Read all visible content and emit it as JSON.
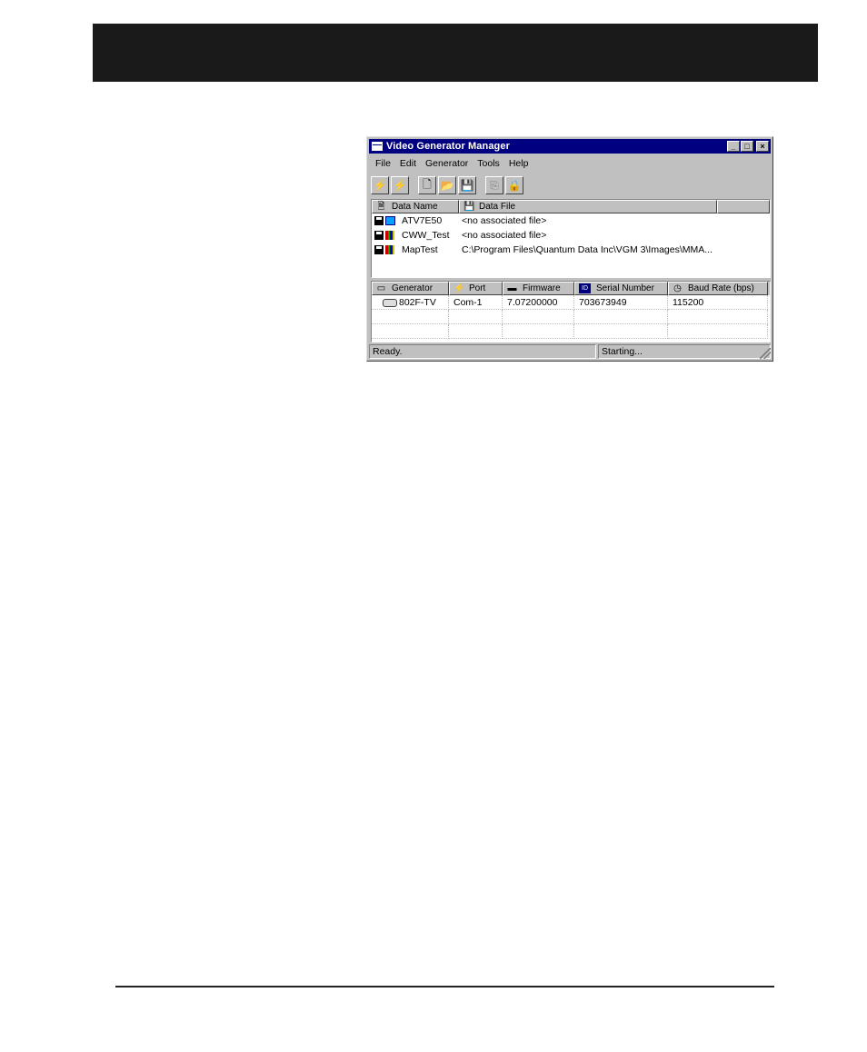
{
  "window": {
    "title": "Video Generator Manager",
    "controls": {
      "minimize": "_",
      "maximize": "□",
      "close": "×"
    }
  },
  "menu": [
    "File",
    "Edit",
    "Generator",
    "Tools",
    "Help"
  ],
  "toolbar": {
    "buttons": [
      {
        "name": "connect-icon",
        "glyph": "⚡"
      },
      {
        "name": "disconnect-icon",
        "glyph": "⚡"
      },
      {
        "name": "new-icon",
        "glyph": "🗋"
      },
      {
        "name": "open-folder-icon",
        "glyph": "📂"
      },
      {
        "name": "save-icon",
        "glyph": "💾"
      },
      {
        "name": "copy-icon",
        "glyph": "⎘"
      },
      {
        "name": "lock-icon",
        "glyph": "🔒"
      }
    ]
  },
  "data_list": {
    "headers": {
      "name": "Data Name",
      "file": "Data File"
    },
    "rows": [
      {
        "name": "ATV7E50",
        "file": "<no associated file>",
        "icon": "monitor-icon"
      },
      {
        "name": "CWW_Test",
        "file": "<no associated file>",
        "icon": "colorbars-icon"
      },
      {
        "name": "MapTest",
        "file": "C:\\Program Files\\Quantum Data Inc\\VGM 3\\Images\\MMA...",
        "icon": "colorbars-icon"
      }
    ]
  },
  "generator_list": {
    "headers": {
      "generator": "Generator",
      "port": "Port",
      "firmware": "Firmware",
      "serial": "Serial Number",
      "baud": "Baud Rate (bps)",
      "id_badge": "ID"
    },
    "rows": [
      {
        "generator": "802F-TV",
        "port": "Com-1",
        "firmware": "7.07200000",
        "serial": "703673949",
        "baud": "115200"
      }
    ]
  },
  "status": {
    "left": "Ready.",
    "right": "Starting..."
  },
  "colors": {
    "titlebar": "#000080",
    "chrome": "#c0c0c0",
    "banner": "#1a1a1a"
  }
}
